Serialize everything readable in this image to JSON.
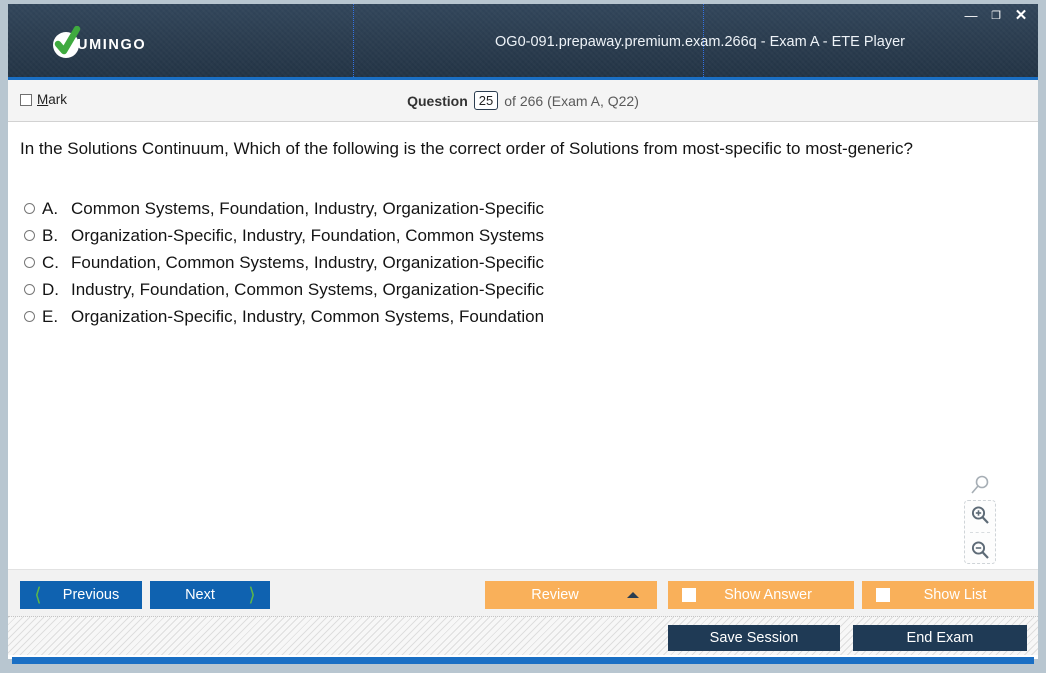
{
  "window": {
    "title": "OG0-091.prepaway.premium.exam.266q - Exam A - ETE Player",
    "logo_text": "UMINGO",
    "controls": {
      "minimize": "—",
      "maximize": "❐",
      "close": "✕"
    },
    "accent_blue": "#1a6fc4",
    "header_navy": "#2b3d50"
  },
  "status_bar": {
    "mark_label_prefix": "M",
    "mark_label_rest": "ark",
    "question_word": "Question",
    "question_number": "25",
    "question_rest": "of 266 (Exam A, Q22)"
  },
  "question": {
    "text": "In the Solutions Continuum, Which of the following is the correct order of Solutions from most-specific to most-generic?",
    "options": [
      {
        "letter": "A.",
        "text": "Common Systems, Foundation, Industry, Organization-Specific"
      },
      {
        "letter": "B.",
        "text": "Organization-Specific, Industry, Foundation, Common Systems"
      },
      {
        "letter": "C.",
        "text": "Foundation, Common Systems, Industry, Organization-Specific"
      },
      {
        "letter": "D.",
        "text": "Industry, Foundation, Common Systems, Organization-Specific"
      },
      {
        "letter": "E.",
        "text": "Organization-Specific, Industry, Common Systems, Foundation"
      }
    ]
  },
  "zoom_widget": {
    "handle_icon": "magnifier-icon",
    "zoom_in_icon": "zoom-in-icon",
    "zoom_out_icon": "zoom-out-icon"
  },
  "toolbar": {
    "previous": "Previous",
    "next": "Next",
    "review": "Review",
    "show_answer": "Show Answer",
    "show_list": "Show List",
    "orange": "#f9b05a",
    "blue": "#0f62b0",
    "chevron_green": "#5bb74a"
  },
  "footer": {
    "save_session": "Save Session",
    "end_exam": "End Exam",
    "dark": "#1f3a55"
  }
}
